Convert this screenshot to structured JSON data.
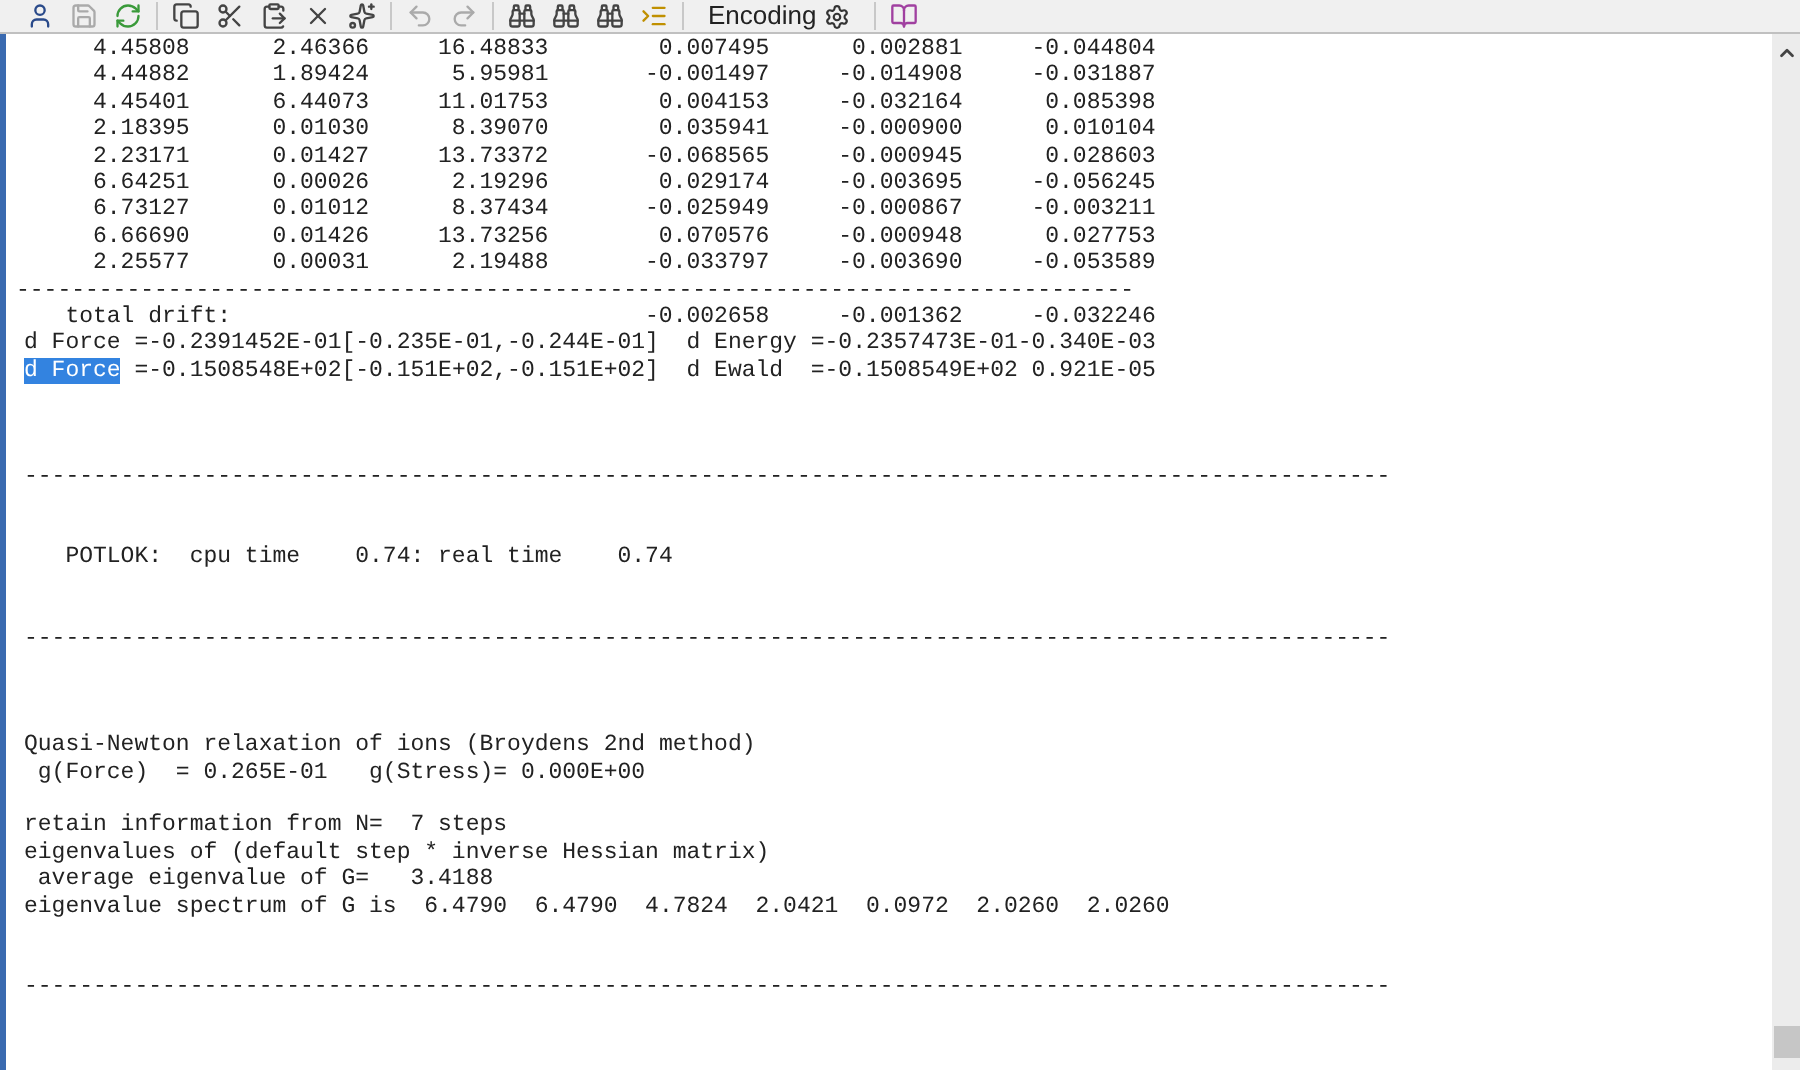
{
  "toolbar": {
    "encoding_button": "Encoding"
  },
  "positions": {
    "rows": [
      [
        "4.45808",
        "2.46366",
        "16.48833",
        "0.007495",
        "0.002881",
        "-0.044804"
      ],
      [
        "4.44882",
        "1.89424",
        "5.95981",
        "-0.001497",
        "-0.014908",
        "-0.031887"
      ],
      [
        "4.45401",
        "6.44073",
        "11.01753",
        "0.004153",
        "-0.032164",
        "0.085398"
      ],
      [
        "2.18395",
        "0.01030",
        "8.39070",
        "0.035941",
        "-0.000900",
        "0.010104"
      ],
      [
        "2.23171",
        "0.01427",
        "13.73372",
        "-0.068565",
        "-0.000945",
        "0.028603"
      ],
      [
        "6.64251",
        "0.00026",
        "2.19296",
        "0.029174",
        "-0.003695",
        "-0.056245"
      ],
      [
        "6.73127",
        "0.01012",
        "8.37434",
        "-0.025949",
        "-0.000867",
        "-0.003211"
      ],
      [
        "6.66690",
        "0.01426",
        "13.73256",
        "0.070576",
        "-0.000948",
        "0.027753"
      ],
      [
        "2.25577",
        "0.00031",
        "2.19488",
        "-0.033797",
        "-0.003690",
        "-0.053589"
      ]
    ],
    "rule": "---------------------------------------------------------------------------------",
    "drift_label": "total drift:",
    "drift": [
      "-0.002658",
      "-0.001362",
      "-0.032246"
    ]
  },
  "lines": [
    {
      "kind": "text",
      "text": "d Force =-0.2391452E-01[-0.235E-01,-0.244E-01]  d Energy =-0.2357473E-01-0.340E-03"
    },
    {
      "kind": "text",
      "selected_text": "d Force",
      "text": " =-0.1508548E+02[-0.151E+02,-0.151E+02]  d Ewald  =-0.1508549E+02 0.921E-05"
    },
    {
      "kind": "blank"
    },
    {
      "kind": "blank"
    },
    {
      "kind": "blank"
    },
    {
      "kind": "rule",
      "text": "---------------------------------------------------------------------------------------------------"
    },
    {
      "kind": "blank"
    },
    {
      "kind": "blank"
    },
    {
      "kind": "text",
      "text": "   POTLOK:  cpu time    0.74: real time    0.74"
    },
    {
      "kind": "blank"
    },
    {
      "kind": "blank"
    },
    {
      "kind": "rule",
      "text": "---------------------------------------------------------------------------------------------------"
    },
    {
      "kind": "blank"
    },
    {
      "kind": "blank"
    },
    {
      "kind": "blank"
    },
    {
      "kind": "text",
      "text": "Quasi-Newton relaxation of ions (Broydens 2nd method)"
    },
    {
      "kind": "text",
      "text": " g(Force)  = 0.265E-01   g(Stress)= 0.000E+00"
    },
    {
      "kind": "blank"
    },
    {
      "kind": "text",
      "text": "retain information from N=  7 steps"
    },
    {
      "kind": "text",
      "text": "eigenvalues of (default step * inverse Hessian matrix)"
    },
    {
      "kind": "text",
      "text": " average eigenvalue of G=   3.4188"
    },
    {
      "kind": "text",
      "text": "eigenvalue spectrum of G is  6.4790  6.4790  4.7824  2.0421  0.0972  2.0260  2.0260"
    },
    {
      "kind": "blank"
    },
    {
      "kind": "blank"
    },
    {
      "kind": "rule",
      "text": "---------------------------------------------------------------------------------------------------"
    }
  ]
}
